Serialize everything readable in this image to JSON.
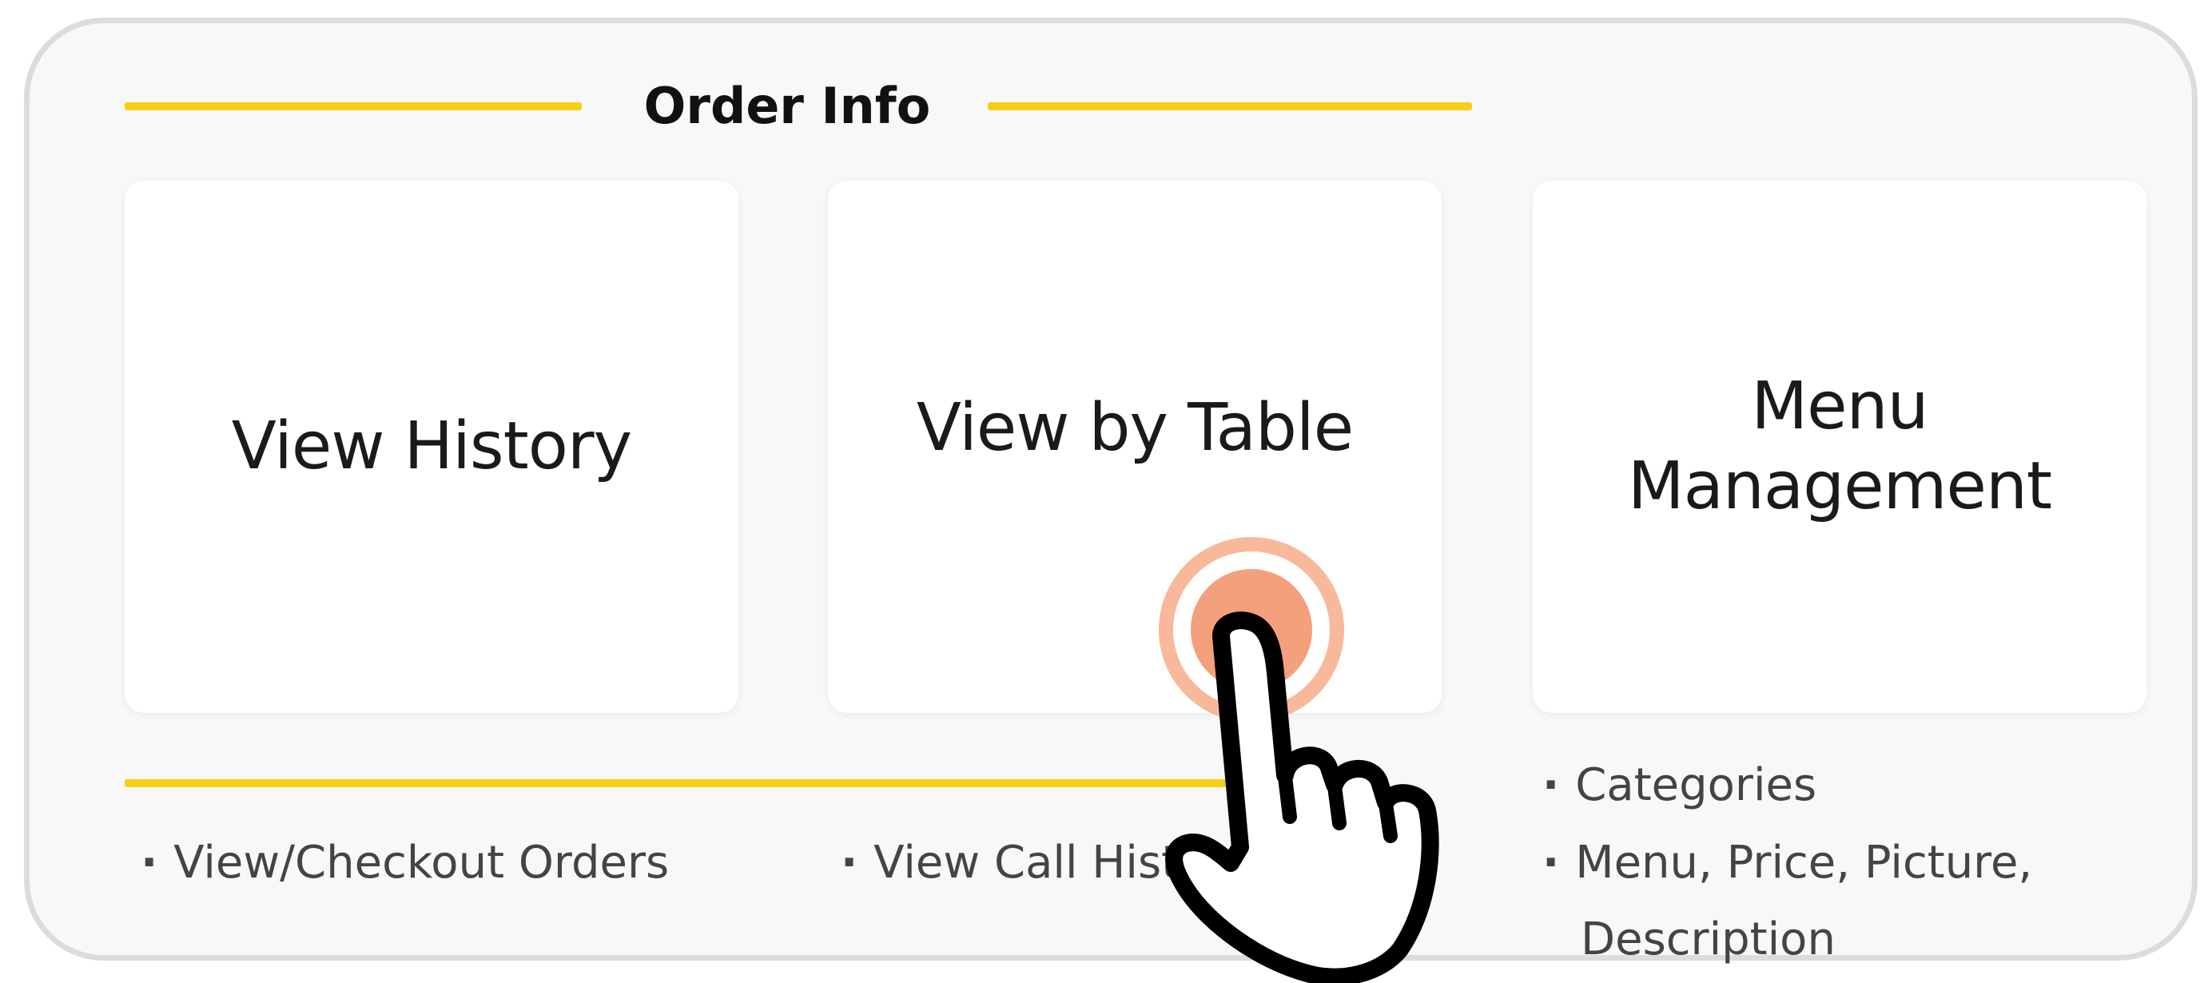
{
  "section": {
    "title": "Order Info"
  },
  "cards": [
    {
      "label": "View History"
    },
    {
      "label": "View by Table"
    },
    {
      "label": "Menu\nManagement"
    }
  ],
  "notes": {
    "history": [
      "View/Checkout Orders"
    ],
    "table": [
      "View Call History"
    ],
    "menu": [
      "Categories",
      "Menu, Price, Picture,",
      "Description"
    ]
  },
  "bullet_glyph": "·",
  "colors": {
    "accent_yellow": "#f6cf16",
    "touch_ring": "#f7b99a",
    "touch_core": "#f4a07c",
    "frame_border": "#dcdcdc"
  },
  "icons": {
    "pointer": "pointing-hand-icon",
    "tap": "tap-ripple-icon"
  }
}
